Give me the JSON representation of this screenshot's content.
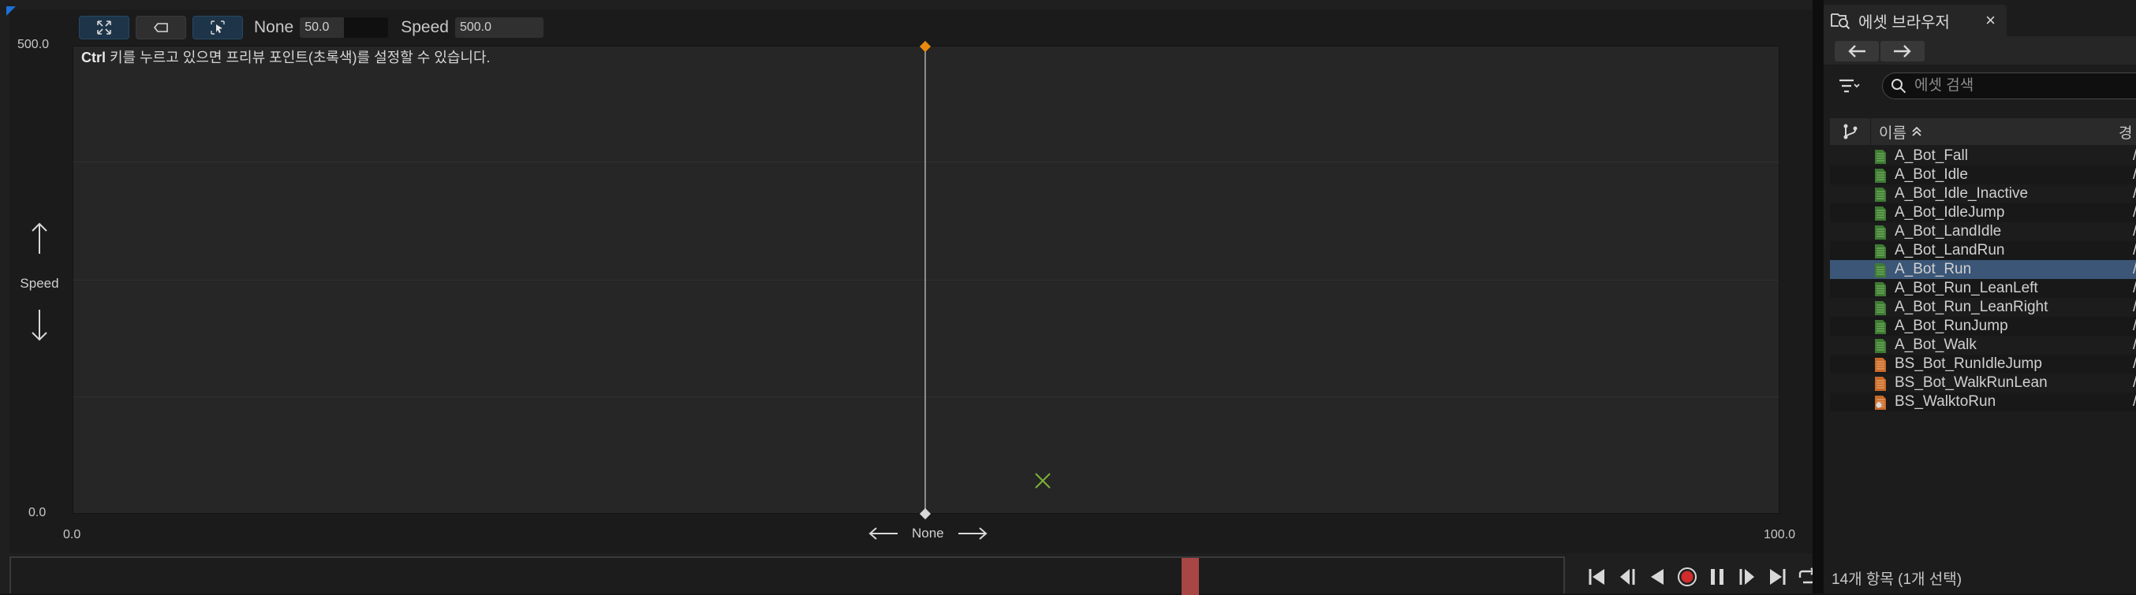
{
  "toolbar": {
    "x_param_label": "None",
    "x_param_value": "50.0",
    "y_param_label": "Speed",
    "y_param_value": "500.0"
  },
  "plot": {
    "hint_bold": "Ctrl",
    "hint_text": " 키를 누르고 있으면 프리뷰 포인트(초록색)를 설정할 수 있습니다.",
    "y_max": "500.0",
    "y_min": "0.0",
    "x_min": "0.0",
    "x_max": "100.0",
    "y_axis_label": "Speed",
    "x_axis_label": "None",
    "sample_color": "#e88a10",
    "preview_color": "#7fb236"
  },
  "timeline": {
    "scrubber_color": "#a84646",
    "record_color": "#d12b2b"
  },
  "browser": {
    "tab_title": "에셋 브라우저",
    "tab_close": "×",
    "search_placeholder": "에셋 검색",
    "col_name": "이름",
    "col_path_partial": "경",
    "path_partial": "/",
    "assets": [
      {
        "name": "A_Bot_Fall",
        "type": "anim"
      },
      {
        "name": "A_Bot_Idle",
        "type": "anim"
      },
      {
        "name": "A_Bot_Idle_Inactive",
        "type": "anim"
      },
      {
        "name": "A_Bot_IdleJump",
        "type": "anim"
      },
      {
        "name": "A_Bot_LandIdle",
        "type": "anim"
      },
      {
        "name": "A_Bot_LandRun",
        "type": "anim"
      },
      {
        "name": "A_Bot_Run",
        "type": "anim",
        "selected": true
      },
      {
        "name": "A_Bot_Run_LeanLeft",
        "type": "anim"
      },
      {
        "name": "A_Bot_Run_LeanRight",
        "type": "anim"
      },
      {
        "name": "A_Bot_RunJump",
        "type": "anim"
      },
      {
        "name": "A_Bot_Walk",
        "type": "anim"
      },
      {
        "name": "BS_Bot_RunIdleJump",
        "type": "blendspace"
      },
      {
        "name": "BS_Bot_WalkRunLean",
        "type": "blendspace"
      },
      {
        "name": "BS_WalktoRun",
        "type": "blendspace-open"
      }
    ],
    "status": "14개 항목 (1개 선택)"
  }
}
